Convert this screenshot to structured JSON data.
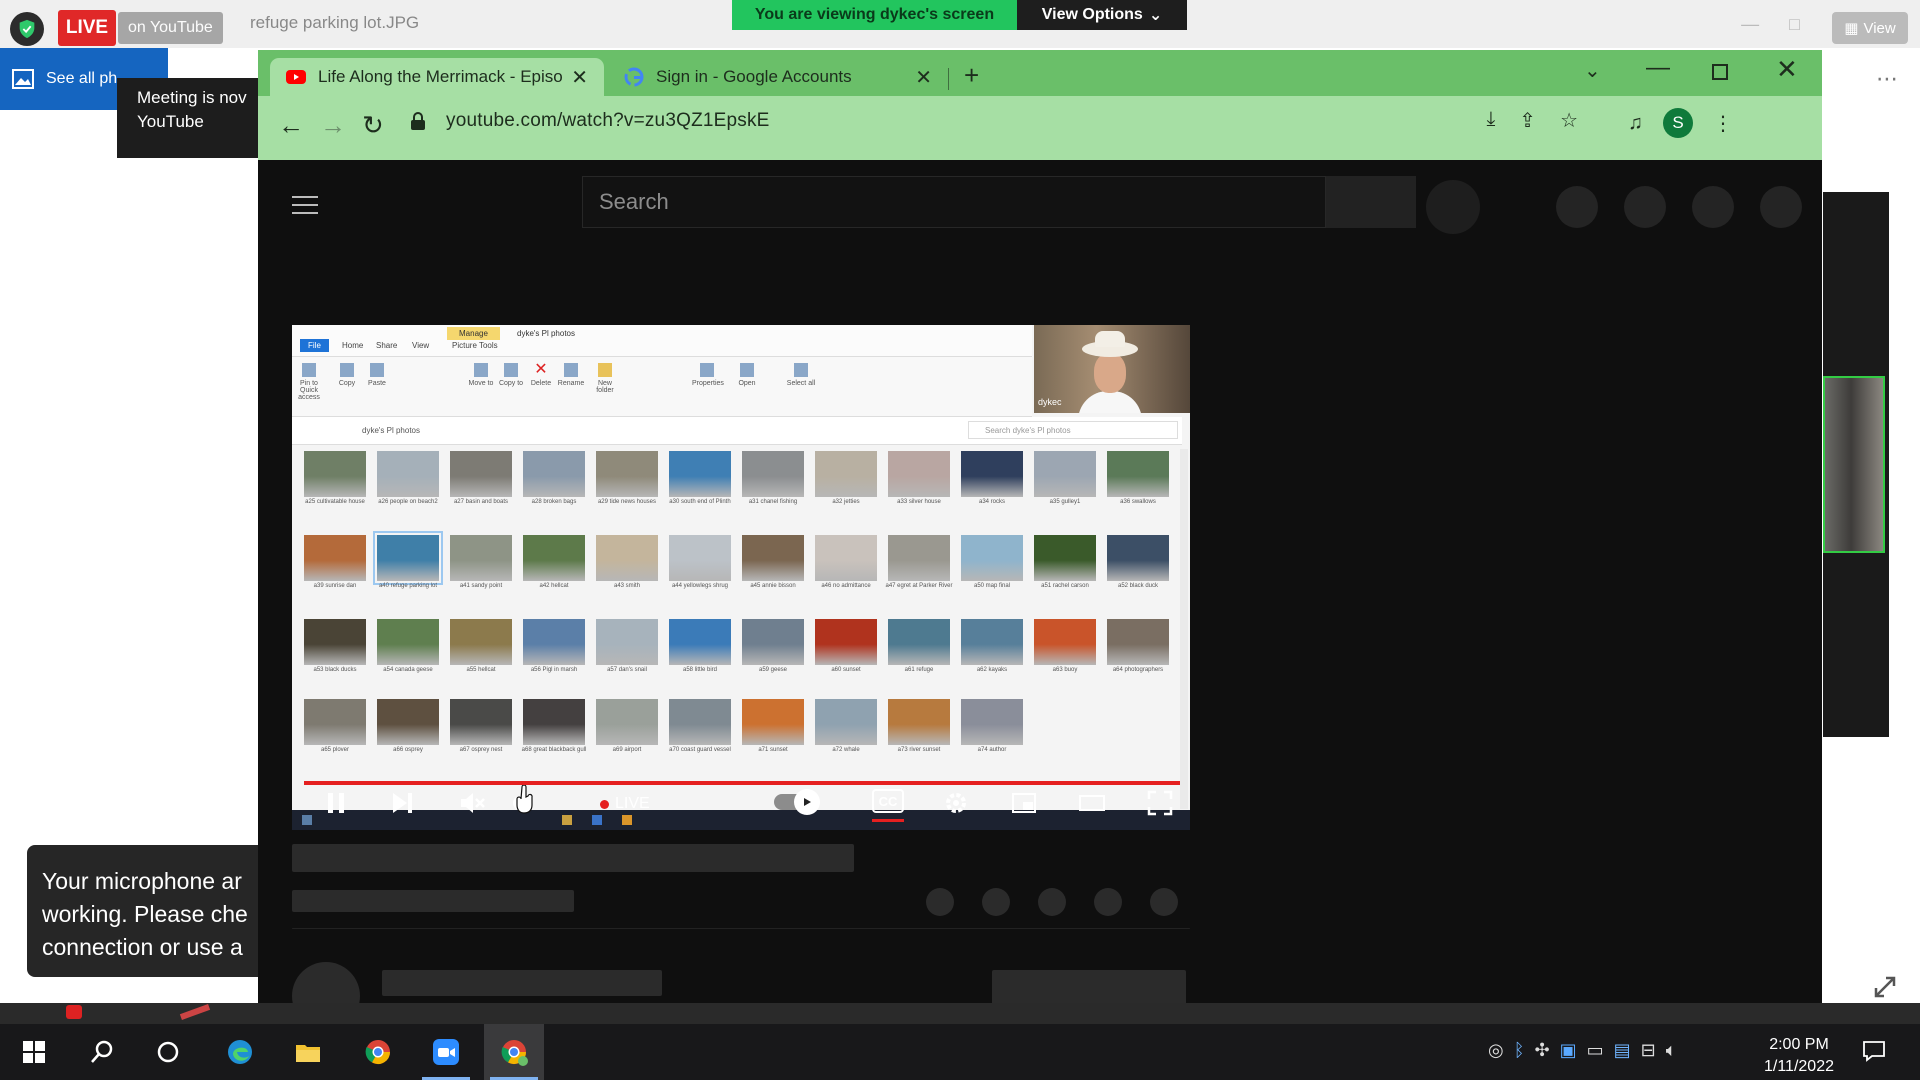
{
  "zoom": {
    "live_label": "LIVE",
    "on_youtube_label": "on YouTube",
    "filename": "refuge parking lot.JPG",
    "viewing_banner": "You are viewing dykec's screen",
    "view_options_label": "View Options",
    "view_button_label": "View",
    "see_all_photos_label": "See all ph",
    "meeting_tooltip": "Meeting is nov\nYouTube",
    "mic_toast": "Your microphone ar\nworking. Please che\nconnection or use a"
  },
  "browser": {
    "tabs": [
      {
        "title": "Life Along the Merrimack - Episo",
        "icon": "youtube-icon"
      },
      {
        "title": "Sign in - Google Accounts",
        "icon": "google-icon"
      }
    ],
    "url": "youtube.com/watch?v=zu3QZ1EpskE",
    "profile_initial": "S"
  },
  "youtube": {
    "search_placeholder": "Search",
    "player": {
      "live_label": "LIVE",
      "cc_label": "CC"
    },
    "shared_screen": {
      "ribbon_tabs": [
        "File",
        "Home",
        "Share",
        "View",
        "Picture Tools"
      ],
      "manage_label": "Manage",
      "folder_title": "dyke's Pl photos",
      "path": "dyke's Pl photos",
      "search_placeholder": "Search dyke's Pl photos",
      "webcam_name": "dykec",
      "ribbon_buttons": [
        "Pin to Quick access",
        "Copy",
        "Paste",
        "Move to",
        "Copy to",
        "Delete",
        "Rename",
        "New folder",
        "Properties",
        "Open",
        "Select all"
      ],
      "photos": [
        "a25 cultivatable house",
        "a26 people on beach2",
        "a27 basin and boats",
        "a28 broken bags",
        "a29 tide news houses",
        "a30 south end of Plinth",
        "a31 chanel fishing",
        "a32 jetties",
        "a33 silver house",
        "a34 rocks",
        "a35 gulley1",
        "a36 swallows",
        "a39 sunrise dan",
        "a40 refuge parking lot",
        "a41 sandy point",
        "a42 hellcat",
        "a43 smith",
        "a44 yellowlegs shrug",
        "a45 annie bisson",
        "a46 no admittance",
        "a47 egret at Parker River",
        "a50 map final",
        "a51 rachel carson",
        "a52 black duck",
        "a53 black ducks",
        "a54 canada geese",
        "a55 hellcat",
        "a56 Pigl in marsh",
        "a57 dan's snail",
        "a58 little bird",
        "a59 geese",
        "a60 sunset",
        "a61 refuge",
        "a62 kayaks",
        "a63 buoy",
        "a64 photographers",
        "a65 plover",
        "a66 osprey",
        "a67 osprey nest",
        "a68 great blackback gull",
        "a69 airport",
        "a70 coast guard vessel",
        "a71 sunset",
        "a72 whale",
        "a73 river sunset",
        "a74 author"
      ],
      "photo_colors": [
        "#6f7f66",
        "#a5b0b9",
        "#7d7b74",
        "#8a9aab",
        "#8f8a7a",
        "#3f7fb4",
        "#8b8e90",
        "#b8b0a2",
        "#b9a6a2",
        "#2f3f5d",
        "#9ca6b2",
        "#5b7a58",
        "#b46a3a",
        "#3f7fa8",
        "#8e9486",
        "#5d7a4a",
        "#c4b59c",
        "#bcc2c8",
        "#7b6650",
        "#c9c2bc",
        "#9a9890",
        "#8fb4cc",
        "#3a5a2a",
        "#3c4f66",
        "#4a4436",
        "#5f7f4f",
        "#8c7a4c",
        "#5b7fa8",
        "#a7b3bc",
        "#3b7bb8",
        "#6f7f8f",
        "#b0331e",
        "#4e7a90",
        "#577f9a",
        "#c9542a",
        "#7a6e62",
        "#7e7a70",
        "#5e5040",
        "#4a4a48",
        "#444040",
        "#9aa09a",
        "#7f8a92",
        "#cc7130",
        "#8fa2b0",
        "#b77a3e",
        "#8a8e9a"
      ]
    }
  },
  "taskbar": {
    "time": "2:00 PM",
    "date": "1/11/2022"
  },
  "colors": {
    "zoom_green": "#22c55e",
    "chrome_green": "#6abf69",
    "youtube_red": "#e52020",
    "live_red": "#e02828"
  }
}
